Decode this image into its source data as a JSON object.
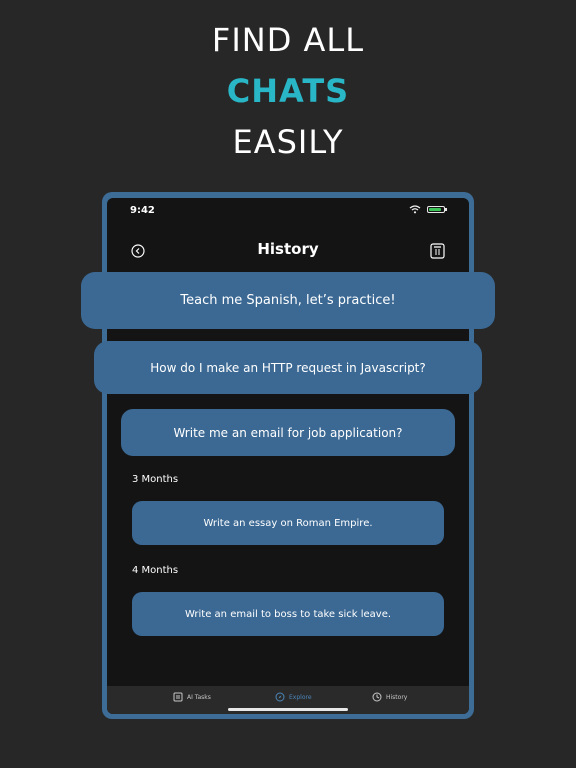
{
  "headline": {
    "line1": "FIND ALL",
    "line2": "CHATS",
    "line3": "EASILY",
    "accent_color": "#29b6c6"
  },
  "status_bar": {
    "time": "9:42",
    "icons": [
      "wifi-icon",
      "battery-charging-icon"
    ]
  },
  "nav": {
    "title": "History",
    "back_icon": "back-circle-icon",
    "delete_icon": "trash-icon"
  },
  "history": {
    "featured": [
      "Teach me Spanish, let’s practice!",
      "How do I make an HTTP request in Javascript?",
      "Write me an email for job application?"
    ],
    "groups": [
      {
        "label": "3 Months",
        "items": [
          "Write an essay on Roman Empire."
        ]
      },
      {
        "label": "4 Months",
        "items": [
          "Write an email to boss to take sick leave."
        ]
      }
    ]
  },
  "tabbar": {
    "tabs": [
      {
        "label": "AI Tasks",
        "icon": "tasks-icon",
        "active": false
      },
      {
        "label": "Explore",
        "icon": "compass-icon",
        "active": true
      },
      {
        "label": "History",
        "icon": "history-icon",
        "active": false
      }
    ]
  },
  "colors": {
    "background": "#272727",
    "frame": "#3d6d97",
    "card": "#3b6994",
    "screen": "#141414"
  }
}
